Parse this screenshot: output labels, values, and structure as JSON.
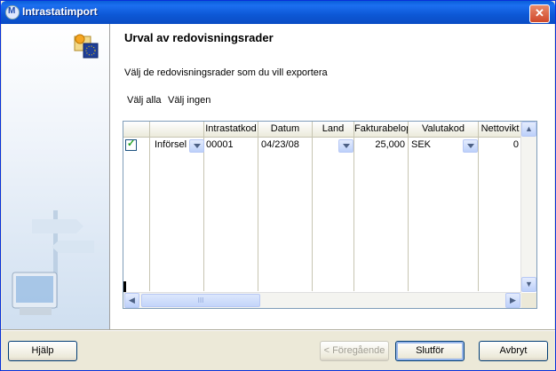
{
  "window": {
    "title": "Intrastatimport",
    "close_label": "✕"
  },
  "page": {
    "heading": "Urval av redovisningsrader",
    "description": "Välj de redovisningsrader som du vill exportera",
    "select_all": "Välj alla",
    "select_none": "Välj ingen"
  },
  "grid": {
    "columns": [
      "Intrastatkod",
      "Datum",
      "Land",
      "Fakturabelop",
      "Valutakod",
      "Nettovikt"
    ],
    "rows": [
      {
        "checked": true,
        "type": "Införsel",
        "intrastatkod": "00001",
        "datum": "04/23/08",
        "land": "",
        "fakturabelopp": "25,000",
        "valutakod": "SEK",
        "nettovikt": "0"
      }
    ],
    "scroll_thumb_grip": "III"
  },
  "buttons": {
    "help": "Hjälp",
    "previous": "< Föregående",
    "finish": "Slutför",
    "cancel": "Avbryt"
  }
}
